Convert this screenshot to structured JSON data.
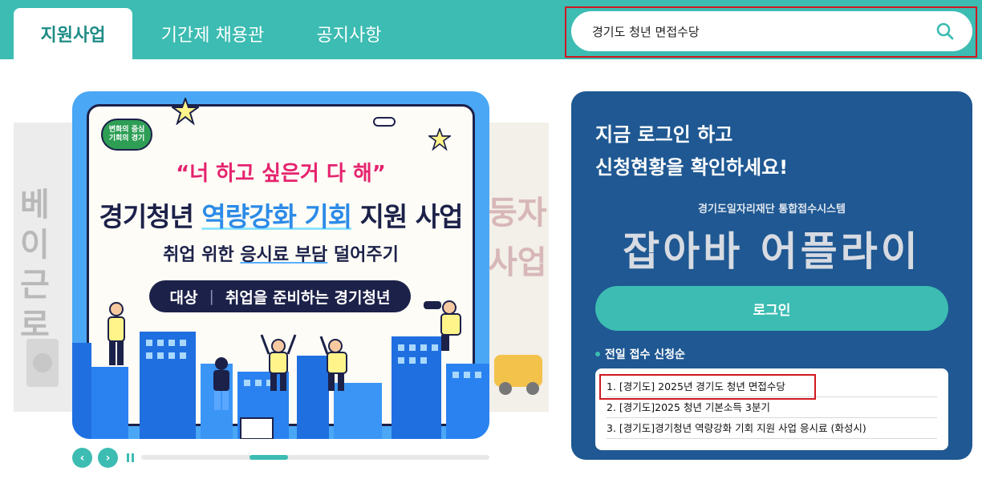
{
  "nav": {
    "tabs": [
      {
        "label": "지원사업",
        "active": true
      },
      {
        "label": "기간제 채용관",
        "active": false
      },
      {
        "label": "공지사항",
        "active": false
      }
    ]
  },
  "search": {
    "value": "경기도 청년 면접수당",
    "icon": "search-icon"
  },
  "banner": {
    "org_badge": "변화의 중심\n기회의 경기",
    "quote": "“너 하고 싶은거 다 해”",
    "title_prefix": "경기청년 ",
    "title_highlight": "역량강화 기회",
    "title_suffix": " 지원 사업",
    "subtitle_prefix": "취업 위한 ",
    "subtitle_underline": "응시료 부담",
    "subtitle_suffix": " 덜어주기",
    "target_label": "대상",
    "target_separator": "|",
    "target_value": "취업을 준비하는 경기청년",
    "left_peek_text": "베이\n근로",
    "right_peek_text": "둥자\n사업",
    "progress_fraction": 0.35
  },
  "carousel_controls": {
    "prev": "‹",
    "next": "›"
  },
  "login": {
    "heading_line1": "지금 로그인 하고",
    "heading_line2": "신청현황을 확인하세요!",
    "system_caption": "경기도일자리재단 통합접수시스템",
    "system_name": "잡아바 어플라이",
    "button_label": "로그인",
    "ranking_title": "전일 접수 신청순",
    "ranking_items": [
      "1. [경기도] 2025년 경기도 청년 면접수당",
      "2. [경기도]2025 청년 기본소득 3분기",
      "3. [경기도]경기청년 역량강화 기회 지원 사업 응시료 (화성시)"
    ]
  },
  "colors": {
    "brand_teal": "#3cbcb2",
    "panel_navy": "#1f5892",
    "banner_blue": "#4aa7f5",
    "highlight_red": "#d01820"
  }
}
